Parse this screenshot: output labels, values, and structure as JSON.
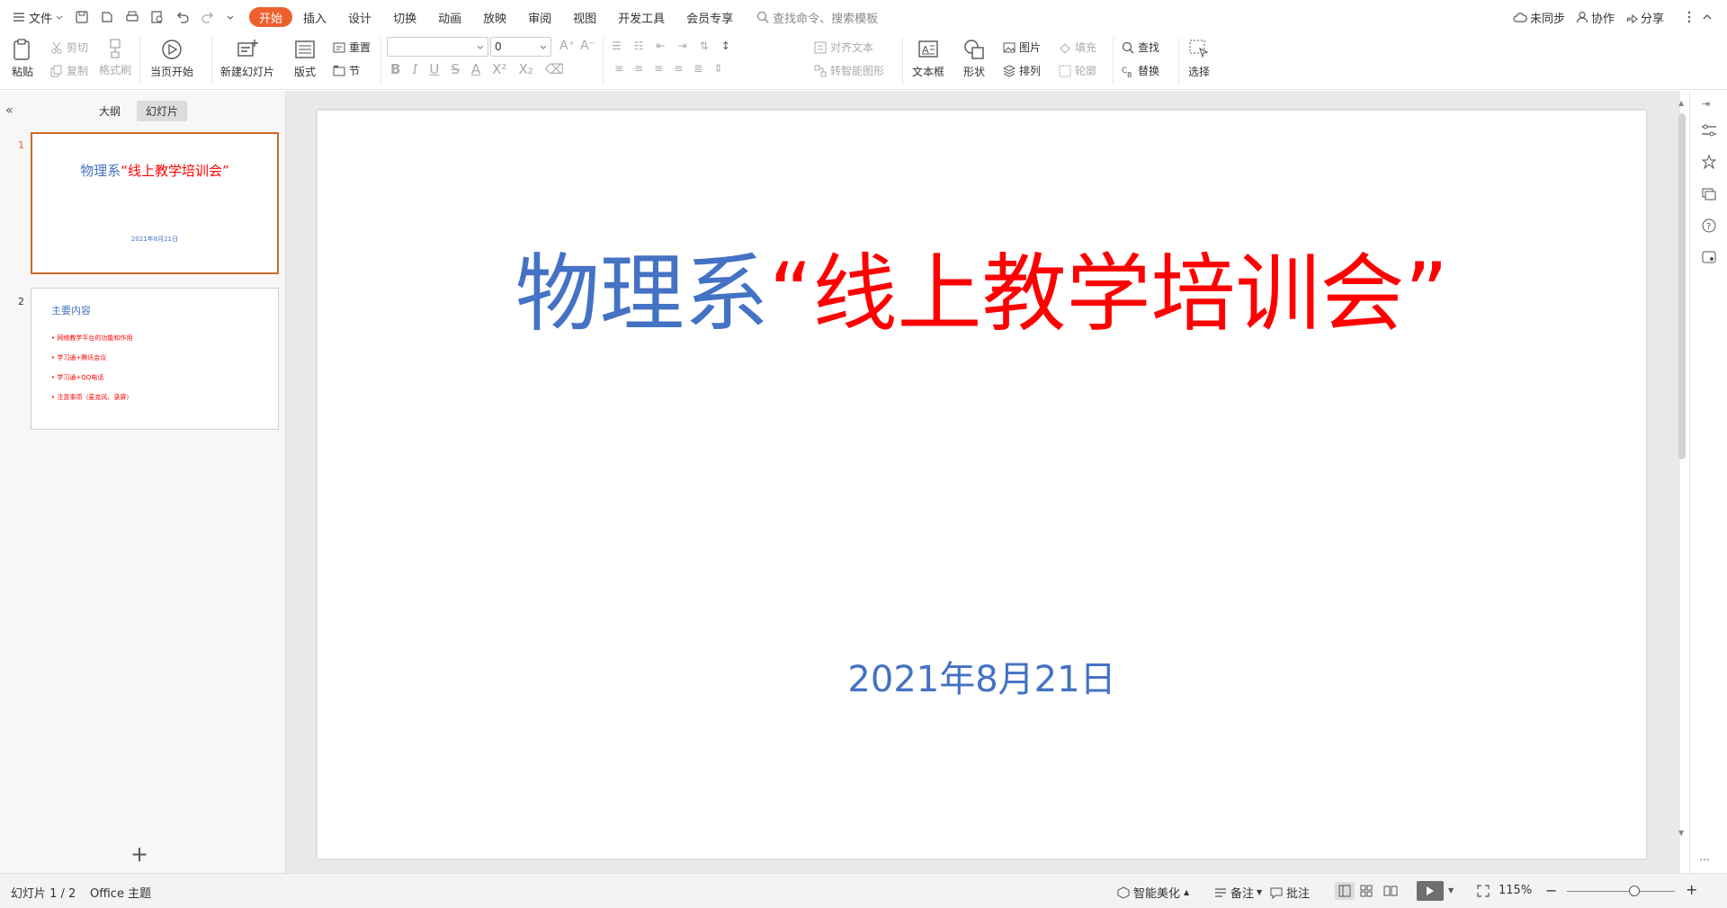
{
  "topbar": {
    "file": "文件",
    "tabs": [
      "开始",
      "插入",
      "设计",
      "切换",
      "动画",
      "放映",
      "审阅",
      "视图",
      "开发工具",
      "会员专享"
    ],
    "search": "查找命令、搜索模板",
    "unsync": "未同步",
    "collab": "协作",
    "share": "分享"
  },
  "ribbon": {
    "paste": "粘贴",
    "cut": "剪切",
    "copy": "复制",
    "format_painter": "格式刷",
    "from_current": "当页开始",
    "new_slide": "新建幻灯片",
    "layout": "版式",
    "reset": "重置",
    "section": "节",
    "font_size": "0",
    "align_text": "对齐文本",
    "smartart": "转智能图形",
    "textbox": "文本框",
    "shape": "形状",
    "picture": "图片",
    "fill": "填充",
    "arrange": "排列",
    "outline": "轮廓",
    "find": "查找",
    "replace": "替换",
    "select": "选择"
  },
  "panel": {
    "outline_tab": "大纲",
    "slides_tab": "幻灯片",
    "add": "+"
  },
  "thumbs": [
    {
      "num": "1",
      "title_a": "物理系",
      "title_b": "“线上教学培训会”",
      "date": "2021年8月21日"
    },
    {
      "num": "2",
      "heading": "主要内容",
      "bullets": [
        "• 网络教学平台的功能和作用",
        "• 学习通+腾讯会议",
        "• 学习通+QQ电话",
        "• 注意事项（麦克风、录屏）"
      ]
    }
  ],
  "slide": {
    "title_a": "物理系",
    "title_b": "“线上教学培训会”",
    "date": "2021年8月21日"
  },
  "status": {
    "slide_count": "幻灯片 1 / 2",
    "theme": "Office 主题",
    "beautify": "智能美化",
    "notes": "备注",
    "comments": "批注",
    "zoom": "115%"
  },
  "colors": {
    "accent": "#ee5f2e",
    "blue": "#4472c4",
    "red": "#ff0000"
  }
}
